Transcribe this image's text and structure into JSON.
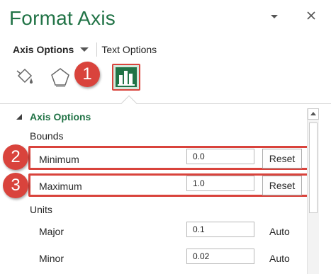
{
  "pane": {
    "title": "Format Axis"
  },
  "options": {
    "axis_options_label": "Axis Options",
    "text_options_label": "Text Options"
  },
  "icons": {
    "fill": "fill-line-icon",
    "effects": "effects-pentagon-icon",
    "axis": "axis-options-bar-chart-icon"
  },
  "callouts": [
    "1",
    "2",
    "3"
  ],
  "section": {
    "title": "Axis Options"
  },
  "bounds": {
    "label": "Bounds",
    "minimum": {
      "label": "Minimum",
      "value": "0.0",
      "button": "Reset"
    },
    "maximum": {
      "label": "Maximum",
      "value": "1.0",
      "button": "Reset"
    }
  },
  "units": {
    "label": "Units",
    "major": {
      "label": "Major",
      "value": "0.1",
      "status": "Auto"
    },
    "minor": {
      "label": "Minor",
      "value": "0.02",
      "status": "Auto"
    }
  },
  "colors": {
    "accent_green": "#217346",
    "callout_red": "#d9433c"
  }
}
